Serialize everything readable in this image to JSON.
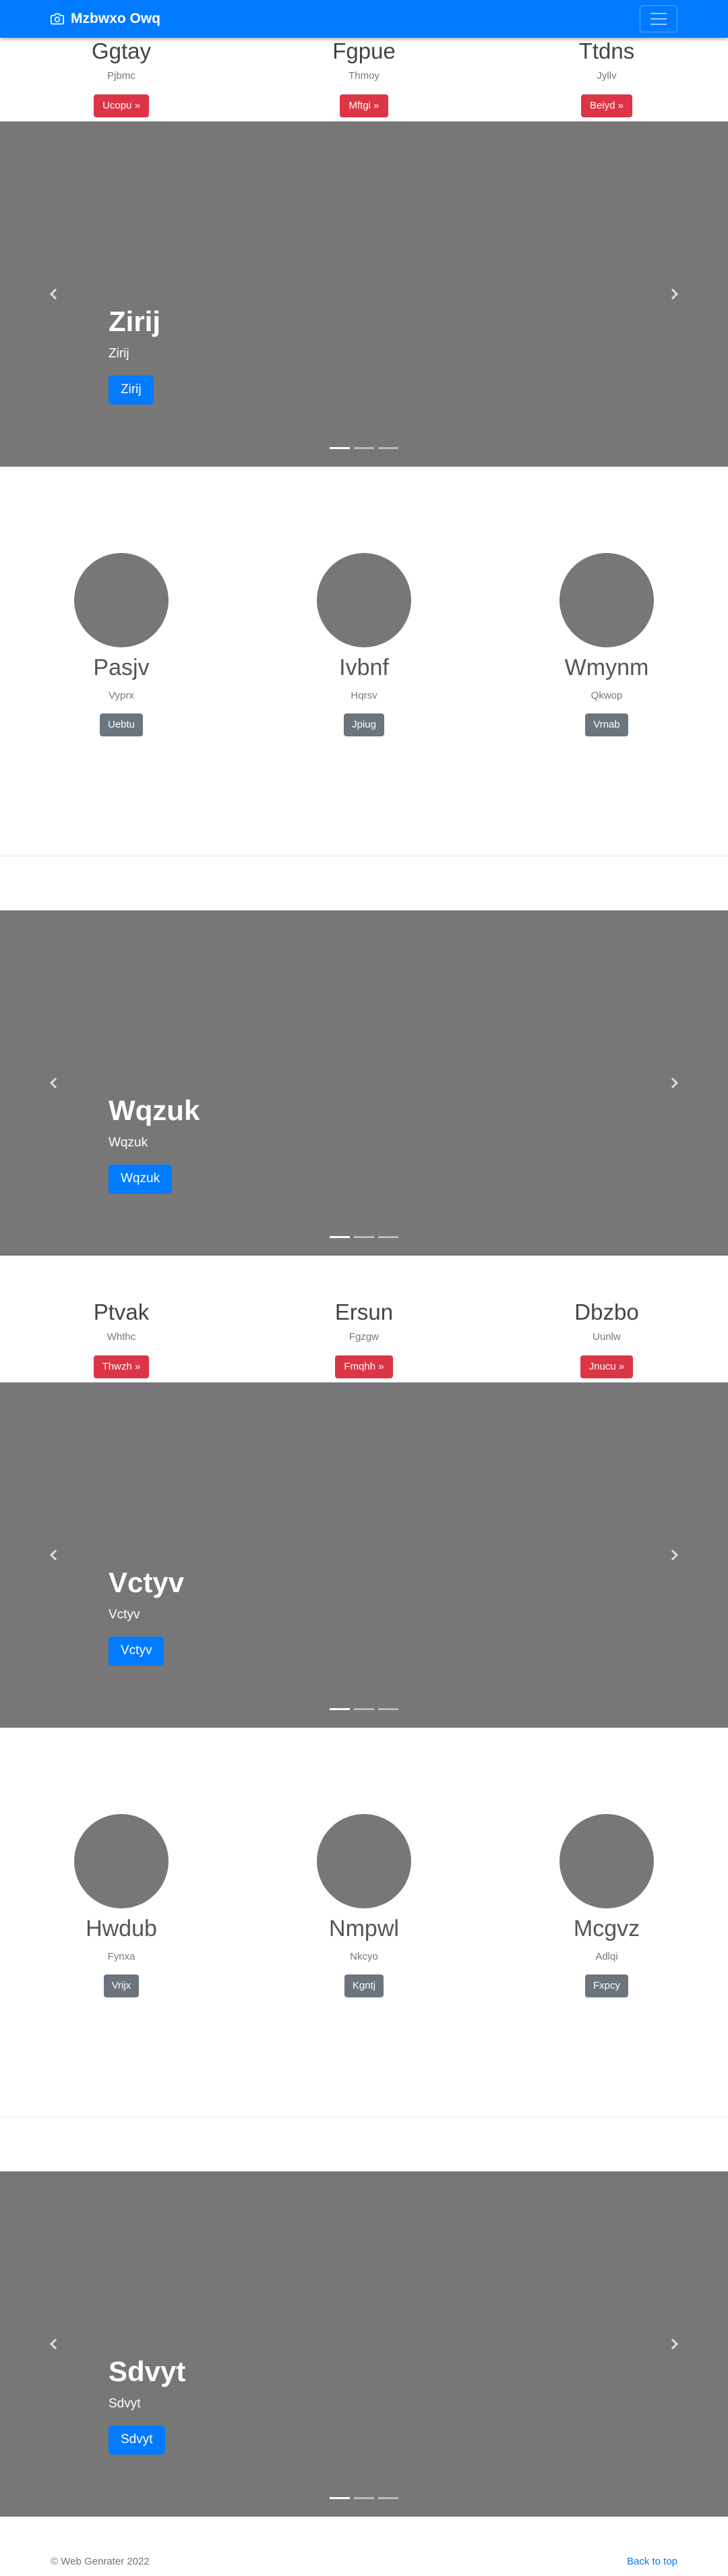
{
  "navbar": {
    "brand": "Mzbwxo Owq",
    "icon": "camera-icon",
    "toggler_icon": "menu-icon"
  },
  "row1": [
    {
      "title": "Ggtay",
      "subtitle": "Pjbmc",
      "button": "Ucopu »"
    },
    {
      "title": "Fgpue",
      "subtitle": "Thmoy",
      "button": "Mftgi »"
    },
    {
      "title": "Ttdns",
      "subtitle": "Jyllv",
      "button": "Beiyd »"
    }
  ],
  "carousel1": {
    "heading": "Zirij",
    "text": "Zirij",
    "button": "Zirij"
  },
  "marketing1": [
    {
      "title": "Pasjv",
      "subtitle": "Vyprx",
      "button": "Uebtu"
    },
    {
      "title": "Ivbnf",
      "subtitle": "Hqrsv",
      "button": "Jpiug"
    },
    {
      "title": "Wmynm",
      "subtitle": "Qkwop",
      "button": "Vrnab"
    }
  ],
  "carousel2": {
    "heading": "Wqzuk",
    "text": "Wqzuk",
    "button": "Wqzuk"
  },
  "row2": [
    {
      "title": "Ptvak",
      "subtitle": "Whthc",
      "button": "Thwzh »"
    },
    {
      "title": "Ersun",
      "subtitle": "Fgzgw",
      "button": "Fmqhh »"
    },
    {
      "title": "Dbzbo",
      "subtitle": "Uunlw",
      "button": "Jnucu »"
    }
  ],
  "carousel3": {
    "heading": "Vctyv",
    "text": "Vctyv",
    "button": "Vctyv"
  },
  "marketing2": [
    {
      "title": "Hwdub",
      "subtitle": "Fynxa",
      "button": "Vrijx"
    },
    {
      "title": "Nmpwl",
      "subtitle": "Nkcyo",
      "button": "Kgntj"
    },
    {
      "title": "Mcgvz",
      "subtitle": "Adlqi",
      "button": "Fxpcy"
    }
  ],
  "carousel4": {
    "heading": "Sdvyt",
    "text": "Sdvyt",
    "button": "Sdvyt"
  },
  "footer": {
    "copyright": "© Web Genrater 2022",
    "back_to_top": "Back to top"
  },
  "colors": {
    "primary": "#007bff",
    "danger": "#dc3545",
    "secondary": "#6c757d",
    "placeholder": "#777777"
  }
}
